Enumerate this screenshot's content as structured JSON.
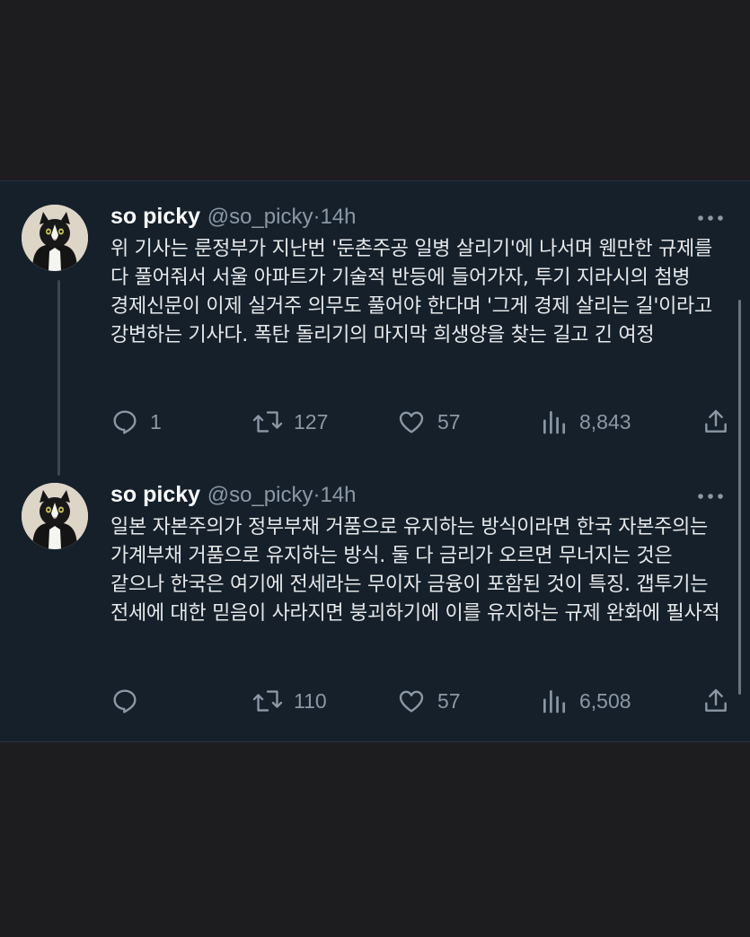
{
  "tweets": [
    {
      "display_name": "so picky",
      "handle": "@so_picky",
      "separator": "·",
      "time": "14h",
      "text": "위 기사는 룬정부가 지난번 '둔촌주공 일병 살리기'에 나서며 웬만한 규제를 다 풀어줘서 서울 아파트가 기술적 반등에 들어가자, 투기 지라시의 첨병 경제신문이 이제 실거주 의무도 풀어야 한다며 '그게 경제 살리는 길'이라고 강변하는 기사다. 폭탄 돌리기의 마지막 희생양을 찾는 길고 긴 여정",
      "replies": "1",
      "retweets": "127",
      "likes": "57",
      "views": "8,843",
      "icons": {
        "reply": "reply-icon",
        "retweet": "retweet-icon",
        "like": "heart-icon",
        "views": "views-icon",
        "share": "share-icon",
        "more": "more-icon"
      }
    },
    {
      "display_name": "so picky",
      "handle": "@so_picky",
      "separator": "·",
      "time": "14h",
      "text": "일본 자본주의가 정부부채 거품으로 유지하는 방식이라면 한국 자본주의는 가계부채 거품으로 유지하는 방식. 둘 다 금리가 오르면 무너지는 것은 같으나 한국은 여기에 전세라는 무이자 금융이 포함된 것이 특징. 갭투기는 전세에 대한 믿음이 사라지면 붕괴하기에 이를 유지하는 규제 완화에 필사적",
      "replies": "",
      "retweets": "110",
      "likes": "57",
      "views": "6,508",
      "icons": {
        "reply": "reply-icon",
        "retweet": "retweet-icon",
        "like": "heart-icon",
        "views": "views-icon",
        "share": "share-icon",
        "more": "more-icon"
      }
    }
  ],
  "colors": {
    "page_background": "#1d1d20",
    "card_background": "#15202b",
    "primary_text": "#e7e9ea",
    "secondary_text": "#8b98a5"
  }
}
